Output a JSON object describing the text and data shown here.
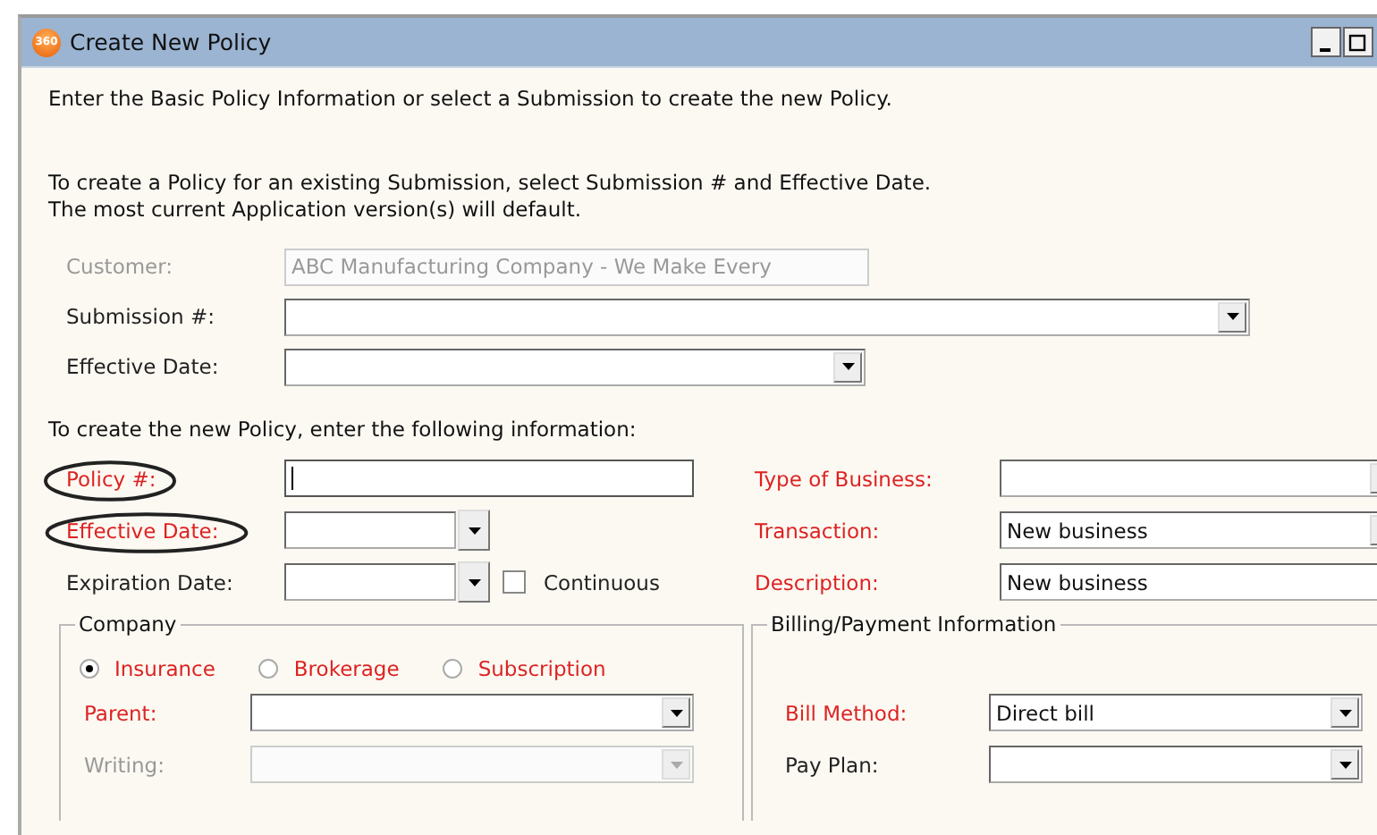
{
  "window": {
    "title": "Create New Policy",
    "logo": "360"
  },
  "intro": "Enter the Basic Policy Information or select a Submission to create the new Policy.",
  "submission_note": [
    "To create a Policy for an existing Submission, select Submission # and Effective Date.",
    "The most current Application version(s) will default."
  ],
  "submission_fields": [
    {
      "label": "Customer:",
      "kind": "text",
      "required": false,
      "disabled": true,
      "value": "ABC Manufacturing Company - We Make Every"
    },
    {
      "label": "Submission #:",
      "kind": "combo",
      "required": false,
      "disabled": false
    },
    {
      "label": "Effective Date:",
      "kind": "combo",
      "required": false,
      "disabled": false
    }
  ],
  "new_policy_note": "To create the new Policy, enter the following information:",
  "policy_fields": [
    {
      "label": "Policy #:",
      "kind": "text",
      "required": true,
      "disabled": false,
      "circled": true,
      "focused": true
    },
    {
      "label": "Effective Date:",
      "kind": "combo",
      "required": true,
      "disabled": false,
      "circled": true,
      "focused": false
    },
    {
      "label": "Expiration Date:",
      "kind": "combo",
      "required": false,
      "disabled": false,
      "circled": false,
      "focused": false
    }
  ],
  "continuous": {
    "label": "Continuous",
    "checked": false
  },
  "business_fields": [
    {
      "label": "Type of Business:",
      "kind": "combo",
      "required": true,
      "disabled": false
    },
    {
      "label": "Transaction:",
      "kind": "combo",
      "required": true,
      "disabled": false,
      "value": "New business"
    },
    {
      "label": "Description:",
      "kind": "text",
      "required": true,
      "disabled": false,
      "value": "New business"
    }
  ],
  "company": {
    "title": "Company",
    "options": [
      {
        "label": "Insurance",
        "selected": true
      },
      {
        "label": "Brokerage",
        "selected": false
      },
      {
        "label": "Subscription",
        "selected": false
      }
    ],
    "fields": [
      {
        "label": "Parent:",
        "kind": "combo",
        "required": true,
        "disabled": false
      },
      {
        "label": "Writing:",
        "kind": "combo",
        "required": false,
        "disabled": true
      }
    ]
  },
  "billing": {
    "title": "Billing/Payment Information",
    "fields": [
      {
        "label": "Bill Method:",
        "kind": "combo",
        "required": true,
        "disabled": false,
        "value": "Direct bill"
      },
      {
        "label": "Pay Plan:",
        "kind": "combo",
        "required": false,
        "disabled": false
      }
    ]
  }
}
